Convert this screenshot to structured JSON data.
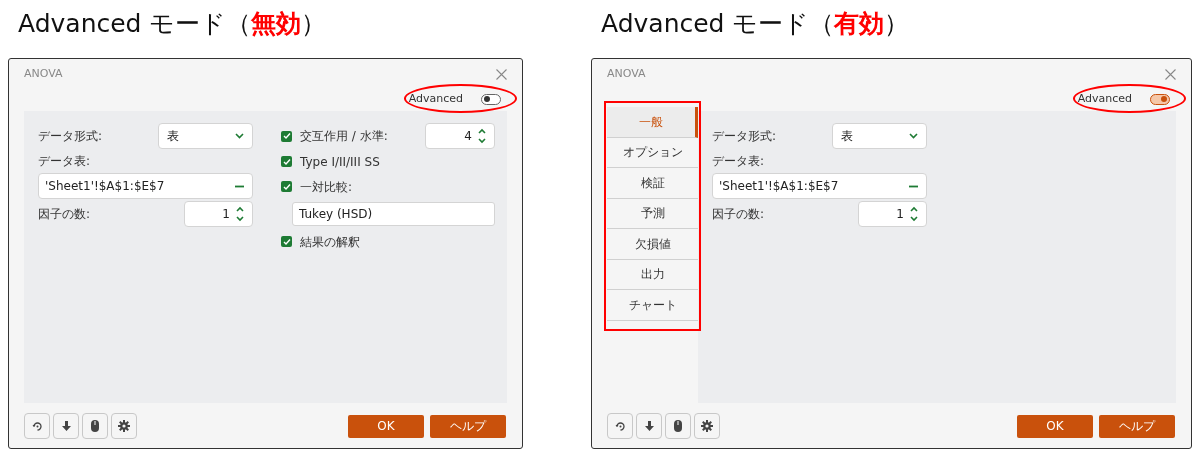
{
  "panels": [
    {
      "heading": {
        "text": "Advanced モード（",
        "emphasis": "無効",
        "suffix": "）"
      },
      "dialog": {
        "title": "ANOVA",
        "advanced": {
          "label": "Advanced",
          "on": false,
          "highlighted": true
        },
        "fields": [
          {
            "kind": "select",
            "label": "データ形式:",
            "value": "表"
          },
          {
            "kind": "range",
            "label": "データ表:",
            "value": "'Sheet1'!$A$1:$E$7"
          },
          {
            "kind": "spinner",
            "label": "因子の数:",
            "value": "1"
          }
        ],
        "options": [
          {
            "kind": "checkbox_spinner",
            "label": "交互作用 / 水準:",
            "checked": true,
            "value": "4"
          },
          {
            "kind": "checkbox",
            "label": "Type I/II/III SS",
            "checked": true
          },
          {
            "kind": "checkbox",
            "label": "一対比較:",
            "checked": true
          },
          {
            "kind": "text",
            "value": "Tukey (HSD)"
          },
          {
            "kind": "checkbox",
            "label": "結果の解釈",
            "checked": true
          }
        ],
        "tool_buttons": [
          {
            "kind": "reset"
          },
          {
            "kind": "download"
          },
          {
            "kind": "mouse"
          },
          {
            "kind": "settings"
          }
        ],
        "buttons": [
          "OK",
          "ヘルプ"
        ]
      }
    },
    {
      "heading": {
        "text": "Advanced モード（",
        "emphasis": "有効",
        "suffix": "）"
      },
      "dialog": {
        "title": "ANOVA",
        "advanced": {
          "label": "Advanced",
          "on": true,
          "highlighted": true
        },
        "sidebar": {
          "highlighted": true,
          "items": [
            {
              "label": "一般",
              "selected": true
            },
            {
              "label": "オプション",
              "selected": false
            },
            {
              "label": "検証",
              "selected": false
            },
            {
              "label": "予測",
              "selected": false
            },
            {
              "label": "欠損値",
              "selected": false
            },
            {
              "label": "出力",
              "selected": false
            },
            {
              "label": "チャート",
              "selected": false
            }
          ]
        },
        "fields": [
          {
            "kind": "select",
            "label": "データ形式:",
            "value": "表"
          },
          {
            "kind": "range",
            "label": "データ表:",
            "value": "'Sheet1'!$A$1:$E$7"
          },
          {
            "kind": "spinner",
            "label": "因子の数:",
            "value": "1"
          }
        ],
        "tool_buttons": [
          {
            "kind": "reset"
          },
          {
            "kind": "download"
          },
          {
            "kind": "mouse"
          },
          {
            "kind": "settings"
          }
        ],
        "buttons": [
          "OK",
          "ヘルプ"
        ]
      }
    }
  ]
}
